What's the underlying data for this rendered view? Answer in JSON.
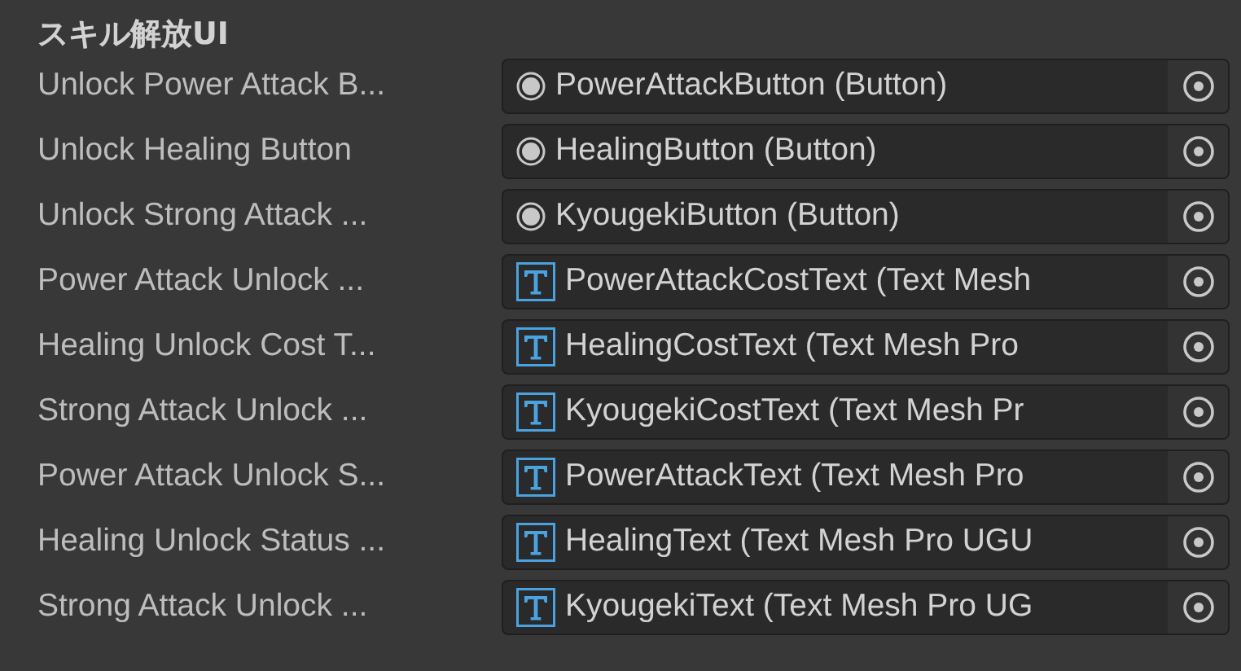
{
  "section_title": "スキル解放UI",
  "fields": [
    {
      "label": "Unlock Power Attack B...",
      "kind": "button",
      "value": "PowerAttackButton (Button)"
    },
    {
      "label": "Unlock Healing Button",
      "kind": "button",
      "value": "HealingButton (Button)"
    },
    {
      "label": "Unlock Strong Attack ...",
      "kind": "button",
      "value": "KyougekiButton (Button)"
    },
    {
      "label": "Power Attack Unlock ...",
      "kind": "text",
      "value": "PowerAttackCostText (Text Mesh"
    },
    {
      "label": "Healing Unlock Cost T...",
      "kind": "text",
      "value": "HealingCostText (Text Mesh Pro"
    },
    {
      "label": "Strong Attack Unlock ...",
      "kind": "text",
      "value": "KyougekiCostText (Text Mesh Pr"
    },
    {
      "label": "Power Attack Unlock S...",
      "kind": "text",
      "value": "PowerAttackText (Text Mesh Pro"
    },
    {
      "label": "Healing Unlock Status ...",
      "kind": "text",
      "value": "HealingText (Text Mesh Pro UGU"
    },
    {
      "label": "Strong Attack Unlock ...",
      "kind": "text",
      "value": "KyougekiText (Text Mesh Pro UG"
    }
  ]
}
